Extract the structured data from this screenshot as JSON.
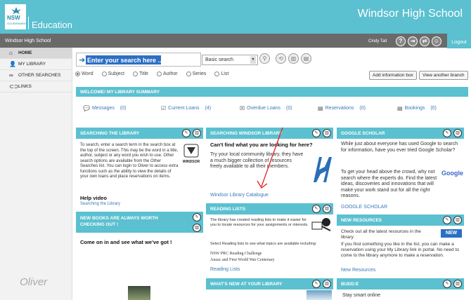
{
  "header": {
    "brand_line1": "NSW",
    "brand_line2": "GOVERNMENT",
    "dept": "Education",
    "school": "Windsor High School"
  },
  "topbar": {
    "school_name": "Windsor High School",
    "user": "Cindy Tait",
    "logout": "Logout",
    "icons": [
      "help-icon",
      "exit-icon",
      "swap-icon",
      "profile-icon"
    ]
  },
  "sidebar": {
    "items": [
      {
        "label": "HOME",
        "icon": "home-icon"
      },
      {
        "label": "MY LIBRARY",
        "icon": "user-icon"
      },
      {
        "label": "OTHER SEARCHES",
        "icon": "binoculars-icon"
      },
      {
        "label": "LINKS",
        "icon": "link-icon"
      }
    ],
    "brand": "Oliver"
  },
  "search": {
    "value": "Enter your search here ...",
    "type": "Basic search",
    "options": [
      "Word",
      "Subject",
      "Title",
      "Author",
      "Series",
      "List"
    ],
    "selected": "Word"
  },
  "buttons": {
    "add_info": "Add information box",
    "view_branch": "View another branch"
  },
  "summary": {
    "title": "WELCOME! MY LIBRARY SUMMARY",
    "items": [
      {
        "label": "Messages",
        "count": "(0)"
      },
      {
        "label": "Current Loans",
        "count": "(4)"
      },
      {
        "label": "Overdue Loans",
        "count": "(0)"
      },
      {
        "label": "Reservations",
        "count": "(0)"
      },
      {
        "label": "Bookings",
        "count": "(0)"
      }
    ]
  },
  "panels": {
    "searching": {
      "title": "SEARCHING THE LIBRARY",
      "body": "To search, enter a search term in the search box at the top of the screen. This may be the word in a title, author, subject or any word you wish to use. Other search options are available from the Other Searches list. You can login to Oliver to access extra functions such as the ability to view the details of your own loans and place reservations on items.",
      "help": "Help video",
      "link": "Searching the Library",
      "logo": "WINDSOR"
    },
    "windsor": {
      "title": "SEARCHING WINDSOR LIBRARY",
      "heading": "Can't find what you are looking for here?",
      "body": "Try your local community library, they have a much bigger collection of resources freely available to all their members.",
      "link": "Windsor Library Catalogue"
    },
    "scholar": {
      "title": "GOOGLE SCHOLAR",
      "body1": "While just about everyone has used Google to search for information, have you ever tried Google Scholar?",
      "body2": "To get your head above the crowd, why not search where the experts do. Find the latest ideas, discoveries and innovations that will make your work stand out for all the right reasons.",
      "link": "GOOGLE SCHOLAR",
      "logo": "Google"
    },
    "newbooks": {
      "title": "NEW BOOKS ARE ALWAYS WORTH CHECKING OUT !",
      "heading": "Come on in and see what we've got !"
    },
    "reading": {
      "title": "READING LISTS",
      "body1": "The library has created reading lists to make it easier for you to locate resources for your assignments or interests.",
      "body2": "Select Reading lists to see what topics are available including:",
      "list1": "NSW PRC Reading Challenge",
      "list2": "Anzac and First World War Centenary",
      "link": "Reading Lists"
    },
    "newres": {
      "title": "NEW RESOURCES",
      "body1": "Check out all the latest resources in the library.",
      "body2": "If you find something you like in the list, you can make a reservation using your My Library link in portal. No need to come to the library anymore to make a reservation.",
      "link": "New Resources",
      "badge": "NEW"
    },
    "whatsnew": {
      "title": "WHAT'S NEW AT YOUR LIBRARY"
    },
    "budde": {
      "title": "BUDD:E",
      "body": "Stay smart online"
    }
  },
  "colors": {
    "accent": "#5bc0d0",
    "topbar": "#6a6a6a",
    "link": "#3a78b8",
    "arrow": "#e02020"
  }
}
